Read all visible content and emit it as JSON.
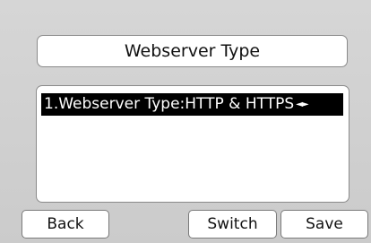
{
  "header": {
    "title": "Webserver Type"
  },
  "list": {
    "items": [
      {
        "label": "1.Webserver Type:HTTP & HTTPS",
        "selected": true,
        "arrows": "◄►"
      }
    ]
  },
  "softkeys": {
    "back": "Back",
    "switch": "Switch",
    "save": "Save"
  },
  "colors": {
    "background": "#cfcfcf",
    "selection": "#000000",
    "panel": "#ffffff"
  }
}
